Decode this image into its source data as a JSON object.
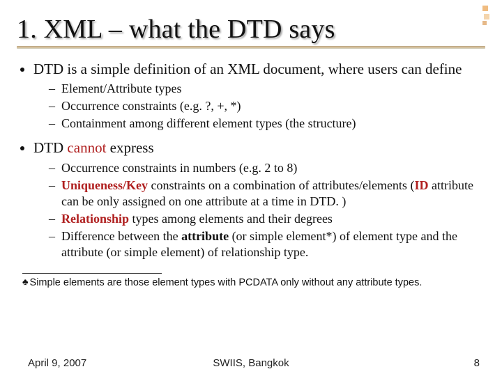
{
  "title": "1. XML – what the DTD says",
  "b1": {
    "intro": "DTD is a simple definition of an XML document, where users can define",
    "s1": "Element/Attribute types",
    "s2": "Occurrence constraints (e.g. ?, +, *)",
    "s3": "Containment among different element types (the structure)"
  },
  "b2": {
    "intro_pre": "DTD ",
    "intro_em": "cannot",
    "intro_post": " express",
    "s1": "Occurrence constraints in numbers (e.g. 2 to 8)",
    "s2_a": "Uniqueness/Key",
    "s2_b": " constraints on a combination of attributes/elements (",
    "s2_c": "ID",
    "s2_d": " attribute can be only assigned on one attribute at a time in DTD. )",
    "s3_a": "Relationship",
    "s3_b": " types among elements and their degrees",
    "s4_a": "Difference between the ",
    "s4_b": "attribute",
    "s4_c": " (or simple element*) of element type and the attribute (or simple element) of relationship type."
  },
  "footnote_mark": "♣",
  "footnote": "Simple elements are those element types with PCDATA only without any attribute types.",
  "footer": {
    "date": "April 9, 2007",
    "venue": "SWIIS, Bangkok",
    "page": "8"
  }
}
